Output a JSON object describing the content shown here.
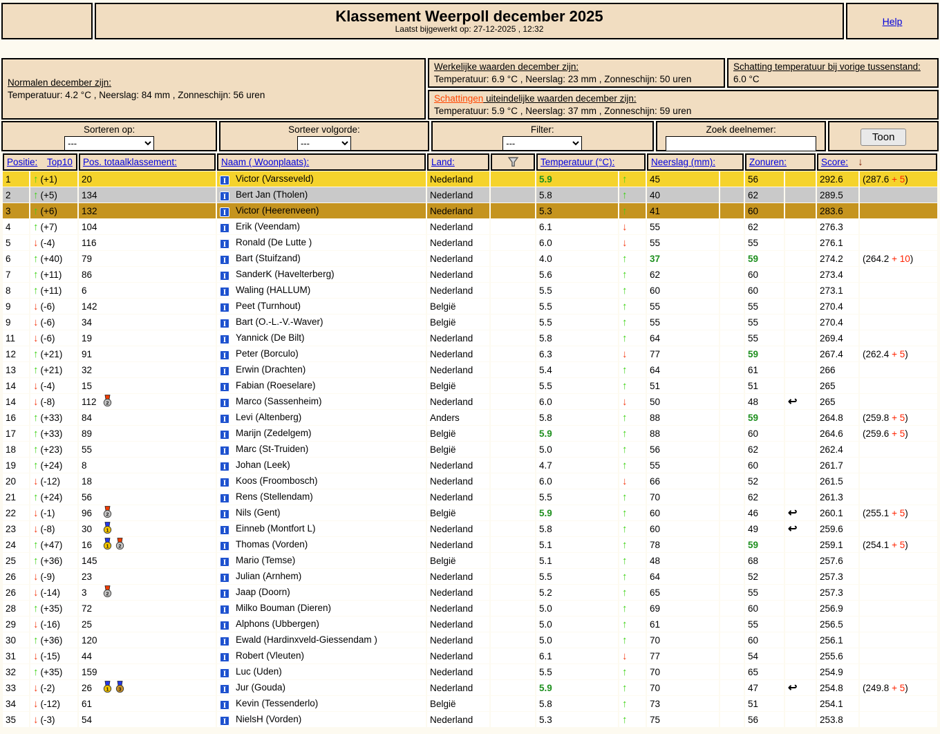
{
  "colors": {
    "page_bg": "#FDFAF0",
    "box_bg": "#F1DDC1",
    "link_blue": "#0000DD",
    "schat_link": "#FF4500",
    "gold_row": "#F5D32C",
    "silver_row": "#C9C9C9",
    "bronze_row": "#C5941F",
    "up_green": "#3BD112",
    "down_red": "#F43B14",
    "hit_green": "#1E8F1E",
    "bonus_red": "#FF2200",
    "score_arrow": "#7A1A00",
    "icon_blue": "#1D51CE"
  },
  "icons": {
    "info": "I",
    "up": "↑",
    "down": "↓",
    "redo": "↩"
  },
  "header": {
    "title": "Klassement Weerpoll december 2025",
    "subtitle": "Laatst bijgewerkt op: 27-12-2025 , 12:32",
    "help_label": "Help"
  },
  "info": {
    "normalen": {
      "title": "Normalen december zijn:",
      "text": "Temperatuur: 4.2 °C , Neerslag: 84 mm , Zonneschijn: 56 uren"
    },
    "werkelijk": {
      "title": "Werkelijke waarden december zijn:",
      "text": "Temperatuur: 6.9 °C , Neerslag: 23 mm , Zonneschijn: 50 uren"
    },
    "schatting_vorige": {
      "title": "Schatting temperatuur bij vorige tussenstand:",
      "text": "6.0 °C"
    },
    "schattingen": {
      "link_text": "Schattingen",
      "title_rest": " uiteindelijke waarden december zijn:",
      "text": "Temperatuur: 5.9 °C , Neerslag: 37 mm , Zonneschijn: 59 uren"
    }
  },
  "controls": {
    "sort_label": "Sorteren op:",
    "sort_value": "---",
    "order_label": "Sorteer volgorde:",
    "order_value": "---",
    "filter_label": "Filter:",
    "filter_value": "---",
    "search_label": "Zoek deelnemer:",
    "search_value": "",
    "show_button": "Toon"
  },
  "table": {
    "headers": {
      "positie": "Positie:",
      "top10": "Top10",
      "pos_totaal": "Pos. totaalklassement:",
      "naam": "Naam ( Woonplaats):",
      "land": "Land:",
      "temperatuur": "Temperatuur (°C):",
      "neerslag": "Neerslag (mm):",
      "zonuren": "Zonuren:",
      "score": "Score:",
      "score_sort_arrow": "↓"
    },
    "medal_defs": {
      "gold1": {
        "num": "1",
        "circle": "#F2C400",
        "ribbon": "#2638E8"
      },
      "silver2": {
        "num": "2",
        "circle": "#C4C4C4",
        "ribbon": "#EE3C00"
      },
      "bronze3": {
        "num": "3",
        "circle": "#C8922A",
        "ribbon": "#2638E8"
      }
    },
    "rows": [
      {
        "positie": "1",
        "delta": "+1",
        "totaal": "20",
        "medals": [],
        "naam": "Victor (Varsseveld)",
        "land": "Nederland",
        "temp": "5.9",
        "temp_hit": true,
        "temp_dir": "up",
        "neerslag": "45",
        "neerslag_hit": false,
        "zonuren": "56",
        "zonuren_hit": false,
        "redo": false,
        "score": "292.6",
        "prev": "287.6",
        "bonus": "5",
        "hl": "gold"
      },
      {
        "positie": "2",
        "delta": "+5",
        "totaal": "134",
        "medals": [],
        "naam": "Bert Jan (Tholen)",
        "land": "Nederland",
        "temp": "5.8",
        "temp_hit": false,
        "temp_dir": "up",
        "neerslag": "40",
        "neerslag_hit": false,
        "zonuren": "62",
        "zonuren_hit": false,
        "redo": false,
        "score": "289.5",
        "prev": null,
        "bonus": null,
        "hl": "silver"
      },
      {
        "positie": "3",
        "delta": "+6",
        "totaal": "132",
        "medals": [],
        "naam": "Victor (Heerenveen)",
        "land": "Nederland",
        "temp": "5.3",
        "temp_hit": false,
        "temp_dir": "up",
        "neerslag": "41",
        "neerslag_hit": false,
        "zonuren": "60",
        "zonuren_hit": false,
        "redo": false,
        "score": "283.6",
        "prev": null,
        "bonus": null,
        "hl": "bronze"
      },
      {
        "positie": "4",
        "delta": "+7",
        "totaal": "104",
        "medals": [],
        "naam": "Erik (Veendam)",
        "land": "Nederland",
        "temp": "6.1",
        "temp_hit": false,
        "temp_dir": "down",
        "neerslag": "55",
        "neerslag_hit": false,
        "zonuren": "62",
        "zonuren_hit": false,
        "redo": false,
        "score": "276.3",
        "prev": null,
        "bonus": null,
        "hl": null
      },
      {
        "positie": "5",
        "delta": "-4",
        "totaal": "116",
        "medals": [],
        "naam": "Ronald (De Lutte )",
        "land": "Nederland",
        "temp": "6.0",
        "temp_hit": false,
        "temp_dir": "down",
        "neerslag": "55",
        "neerslag_hit": false,
        "zonuren": "55",
        "zonuren_hit": false,
        "redo": false,
        "score": "276.1",
        "prev": null,
        "bonus": null,
        "hl": null
      },
      {
        "positie": "6",
        "delta": "+40",
        "totaal": "79",
        "medals": [],
        "naam": "Bart (Stuifzand)",
        "land": "Nederland",
        "temp": "4.0",
        "temp_hit": false,
        "temp_dir": "up",
        "neerslag": "37",
        "neerslag_hit": true,
        "zonuren": "59",
        "zonuren_hit": true,
        "redo": false,
        "score": "274.2",
        "prev": "264.2",
        "bonus": "10",
        "hl": null
      },
      {
        "positie": "7",
        "delta": "+11",
        "totaal": "86",
        "medals": [],
        "naam": "SanderK (Havelterberg)",
        "land": "Nederland",
        "temp": "5.6",
        "temp_hit": false,
        "temp_dir": "up",
        "neerslag": "62",
        "neerslag_hit": false,
        "zonuren": "60",
        "zonuren_hit": false,
        "redo": false,
        "score": "273.4",
        "prev": null,
        "bonus": null,
        "hl": null
      },
      {
        "positie": "8",
        "delta": "+11",
        "totaal": "6",
        "medals": [],
        "naam": "Waling (HALLUM)",
        "land": "Nederland",
        "temp": "5.5",
        "temp_hit": false,
        "temp_dir": "up",
        "neerslag": "60",
        "neerslag_hit": false,
        "zonuren": "60",
        "zonuren_hit": false,
        "redo": false,
        "score": "273.1",
        "prev": null,
        "bonus": null,
        "hl": null
      },
      {
        "positie": "9",
        "delta": "-6",
        "totaal": "142",
        "medals": [],
        "naam": "Peet (Turnhout)",
        "land": "België",
        "temp": "5.5",
        "temp_hit": false,
        "temp_dir": "up",
        "neerslag": "55",
        "neerslag_hit": false,
        "zonuren": "55",
        "zonuren_hit": false,
        "redo": false,
        "score": "270.4",
        "prev": null,
        "bonus": null,
        "hl": null
      },
      {
        "positie": "9",
        "delta": "-6",
        "totaal": "34",
        "medals": [],
        "naam": "Bart (O.-L.-V.-Waver)",
        "land": "België",
        "temp": "5.5",
        "temp_hit": false,
        "temp_dir": "up",
        "neerslag": "55",
        "neerslag_hit": false,
        "zonuren": "55",
        "zonuren_hit": false,
        "redo": false,
        "score": "270.4",
        "prev": null,
        "bonus": null,
        "hl": null
      },
      {
        "positie": "11",
        "delta": "-6",
        "totaal": "19",
        "medals": [],
        "naam": "Yannick (De Bilt)",
        "land": "Nederland",
        "temp": "5.8",
        "temp_hit": false,
        "temp_dir": "up",
        "neerslag": "64",
        "neerslag_hit": false,
        "zonuren": "55",
        "zonuren_hit": false,
        "redo": false,
        "score": "269.4",
        "prev": null,
        "bonus": null,
        "hl": null
      },
      {
        "positie": "12",
        "delta": "+21",
        "totaal": "91",
        "medals": [],
        "naam": "Peter (Borculo)",
        "land": "Nederland",
        "temp": "6.3",
        "temp_hit": false,
        "temp_dir": "down",
        "neerslag": "77",
        "neerslag_hit": false,
        "zonuren": "59",
        "zonuren_hit": true,
        "redo": false,
        "score": "267.4",
        "prev": "262.4",
        "bonus": "5",
        "hl": null
      },
      {
        "positie": "13",
        "delta": "+21",
        "totaal": "32",
        "medals": [],
        "naam": "Erwin (Drachten)",
        "land": "Nederland",
        "temp": "5.4",
        "temp_hit": false,
        "temp_dir": "up",
        "neerslag": "64",
        "neerslag_hit": false,
        "zonuren": "61",
        "zonuren_hit": false,
        "redo": false,
        "score": "266",
        "prev": null,
        "bonus": null,
        "hl": null
      },
      {
        "positie": "14",
        "delta": "-4",
        "totaal": "15",
        "medals": [],
        "naam": "Fabian (Roeselare)",
        "land": "België",
        "temp": "5.5",
        "temp_hit": false,
        "temp_dir": "up",
        "neerslag": "51",
        "neerslag_hit": false,
        "zonuren": "51",
        "zonuren_hit": false,
        "redo": false,
        "score": "265",
        "prev": null,
        "bonus": null,
        "hl": null
      },
      {
        "positie": "14",
        "delta": "-8",
        "totaal": "112",
        "medals": [
          "silver2"
        ],
        "naam": "Marco (Sassenheim)",
        "land": "Nederland",
        "temp": "6.0",
        "temp_hit": false,
        "temp_dir": "down",
        "neerslag": "50",
        "neerslag_hit": false,
        "zonuren": "48",
        "zonuren_hit": false,
        "redo": true,
        "score": "265",
        "prev": null,
        "bonus": null,
        "hl": null
      },
      {
        "positie": "16",
        "delta": "+33",
        "totaal": "84",
        "medals": [],
        "naam": "Levi (Altenberg)",
        "land": "Anders",
        "temp": "5.8",
        "temp_hit": false,
        "temp_dir": "up",
        "neerslag": "88",
        "neerslag_hit": false,
        "zonuren": "59",
        "zonuren_hit": true,
        "redo": false,
        "score": "264.8",
        "prev": "259.8",
        "bonus": "5",
        "hl": null
      },
      {
        "positie": "17",
        "delta": "+33",
        "totaal": "89",
        "medals": [],
        "naam": "Marijn (Zedelgem)",
        "land": "België",
        "temp": "5.9",
        "temp_hit": true,
        "temp_dir": "up",
        "neerslag": "88",
        "neerslag_hit": false,
        "zonuren": "60",
        "zonuren_hit": false,
        "redo": false,
        "score": "264.6",
        "prev": "259.6",
        "bonus": "5",
        "hl": null
      },
      {
        "positie": "18",
        "delta": "+23",
        "totaal": "55",
        "medals": [],
        "naam": "Marc (St-Truiden)",
        "land": "België",
        "temp": "5.0",
        "temp_hit": false,
        "temp_dir": "up",
        "neerslag": "56",
        "neerslag_hit": false,
        "zonuren": "62",
        "zonuren_hit": false,
        "redo": false,
        "score": "262.4",
        "prev": null,
        "bonus": null,
        "hl": null
      },
      {
        "positie": "19",
        "delta": "+24",
        "totaal": "8",
        "medals": [],
        "naam": "Johan (Leek)",
        "land": "Nederland",
        "temp": "4.7",
        "temp_hit": false,
        "temp_dir": "up",
        "neerslag": "55",
        "neerslag_hit": false,
        "zonuren": "60",
        "zonuren_hit": false,
        "redo": false,
        "score": "261.7",
        "prev": null,
        "bonus": null,
        "hl": null
      },
      {
        "positie": "20",
        "delta": "-12",
        "totaal": "18",
        "medals": [],
        "naam": "Koos (Froombosch)",
        "land": "Nederland",
        "temp": "6.0",
        "temp_hit": false,
        "temp_dir": "down",
        "neerslag": "66",
        "neerslag_hit": false,
        "zonuren": "52",
        "zonuren_hit": false,
        "redo": false,
        "score": "261.5",
        "prev": null,
        "bonus": null,
        "hl": null
      },
      {
        "positie": "21",
        "delta": "+24",
        "totaal": "56",
        "medals": [],
        "naam": "Rens (Stellendam)",
        "land": "Nederland",
        "temp": "5.5",
        "temp_hit": false,
        "temp_dir": "up",
        "neerslag": "70",
        "neerslag_hit": false,
        "zonuren": "62",
        "zonuren_hit": false,
        "redo": false,
        "score": "261.3",
        "prev": null,
        "bonus": null,
        "hl": null
      },
      {
        "positie": "22",
        "delta": "-1",
        "totaal": "96",
        "medals": [
          "silver2"
        ],
        "naam": "Nils (Gent)",
        "land": "België",
        "temp": "5.9",
        "temp_hit": true,
        "temp_dir": "up",
        "neerslag": "60",
        "neerslag_hit": false,
        "zonuren": "46",
        "zonuren_hit": false,
        "redo": true,
        "score": "260.1",
        "prev": "255.1",
        "bonus": "5",
        "hl": null
      },
      {
        "positie": "23",
        "delta": "-8",
        "totaal": "30",
        "medals": [
          "gold1"
        ],
        "naam": "Einneb (Montfort L)",
        "land": "Nederland",
        "temp": "5.8",
        "temp_hit": false,
        "temp_dir": "up",
        "neerslag": "60",
        "neerslag_hit": false,
        "zonuren": "49",
        "zonuren_hit": false,
        "redo": true,
        "score": "259.6",
        "prev": null,
        "bonus": null,
        "hl": null
      },
      {
        "positie": "24",
        "delta": "+47",
        "totaal": "16",
        "medals": [
          "gold1",
          "silver2"
        ],
        "naam": "Thomas (Vorden)",
        "land": "Nederland",
        "temp": "5.1",
        "temp_hit": false,
        "temp_dir": "up",
        "neerslag": "78",
        "neerslag_hit": false,
        "zonuren": "59",
        "zonuren_hit": true,
        "redo": false,
        "score": "259.1",
        "prev": "254.1",
        "bonus": "5",
        "hl": null
      },
      {
        "positie": "25",
        "delta": "+36",
        "totaal": "145",
        "medals": [],
        "naam": "Mario (Temse)",
        "land": "België",
        "temp": "5.1",
        "temp_hit": false,
        "temp_dir": "up",
        "neerslag": "48",
        "neerslag_hit": false,
        "zonuren": "68",
        "zonuren_hit": false,
        "redo": false,
        "score": "257.6",
        "prev": null,
        "bonus": null,
        "hl": null
      },
      {
        "positie": "26",
        "delta": "-9",
        "totaal": "23",
        "medals": [],
        "naam": "Julian (Arnhem)",
        "land": "Nederland",
        "temp": "5.5",
        "temp_hit": false,
        "temp_dir": "up",
        "neerslag": "64",
        "neerslag_hit": false,
        "zonuren": "52",
        "zonuren_hit": false,
        "redo": false,
        "score": "257.3",
        "prev": null,
        "bonus": null,
        "hl": null
      },
      {
        "positie": "26",
        "delta": "-14",
        "totaal": "3",
        "medals": [
          "silver2"
        ],
        "naam": "Jaap (Doorn)",
        "land": "Nederland",
        "temp": "5.2",
        "temp_hit": false,
        "temp_dir": "up",
        "neerslag": "65",
        "neerslag_hit": false,
        "zonuren": "55",
        "zonuren_hit": false,
        "redo": false,
        "score": "257.3",
        "prev": null,
        "bonus": null,
        "hl": null
      },
      {
        "positie": "28",
        "delta": "+35",
        "totaal": "72",
        "medals": [],
        "naam": "Milko Bouman (Dieren)",
        "land": "Nederland",
        "temp": "5.0",
        "temp_hit": false,
        "temp_dir": "up",
        "neerslag": "69",
        "neerslag_hit": false,
        "zonuren": "60",
        "zonuren_hit": false,
        "redo": false,
        "score": "256.9",
        "prev": null,
        "bonus": null,
        "hl": null
      },
      {
        "positie": "29",
        "delta": "-16",
        "totaal": "25",
        "medals": [],
        "naam": "Alphons (Ubbergen)",
        "land": "Nederland",
        "temp": "5.0",
        "temp_hit": false,
        "temp_dir": "up",
        "neerslag": "61",
        "neerslag_hit": false,
        "zonuren": "55",
        "zonuren_hit": false,
        "redo": false,
        "score": "256.5",
        "prev": null,
        "bonus": null,
        "hl": null
      },
      {
        "positie": "30",
        "delta": "+36",
        "totaal": "120",
        "medals": [],
        "naam": "Ewald (Hardinxveld-Giessendam )",
        "land": "Nederland",
        "temp": "5.0",
        "temp_hit": false,
        "temp_dir": "up",
        "neerslag": "70",
        "neerslag_hit": false,
        "zonuren": "60",
        "zonuren_hit": false,
        "redo": false,
        "score": "256.1",
        "prev": null,
        "bonus": null,
        "hl": null
      },
      {
        "positie": "31",
        "delta": "-15",
        "totaal": "44",
        "medals": [],
        "naam": "Robert (Vleuten)",
        "land": "Nederland",
        "temp": "6.1",
        "temp_hit": false,
        "temp_dir": "down",
        "neerslag": "77",
        "neerslag_hit": false,
        "zonuren": "54",
        "zonuren_hit": false,
        "redo": false,
        "score": "255.6",
        "prev": null,
        "bonus": null,
        "hl": null
      },
      {
        "positie": "32",
        "delta": "+35",
        "totaal": "159",
        "medals": [],
        "naam": "Luc (Uden)",
        "land": "Nederland",
        "temp": "5.5",
        "temp_hit": false,
        "temp_dir": "up",
        "neerslag": "70",
        "neerslag_hit": false,
        "zonuren": "65",
        "zonuren_hit": false,
        "redo": false,
        "score": "254.9",
        "prev": null,
        "bonus": null,
        "hl": null
      },
      {
        "positie": "33",
        "delta": "-2",
        "totaal": "26",
        "medals": [
          "gold1",
          "bronze3"
        ],
        "naam": "Jur (Gouda)",
        "land": "Nederland",
        "temp": "5.9",
        "temp_hit": true,
        "temp_dir": "up",
        "neerslag": "70",
        "neerslag_hit": false,
        "zonuren": "47",
        "zonuren_hit": false,
        "redo": true,
        "score": "254.8",
        "prev": "249.8",
        "bonus": "5",
        "hl": null
      },
      {
        "positie": "34",
        "delta": "-12",
        "totaal": "61",
        "medals": [],
        "naam": "Kevin (Tessenderlo)",
        "land": "België",
        "temp": "5.8",
        "temp_hit": false,
        "temp_dir": "up",
        "neerslag": "73",
        "neerslag_hit": false,
        "zonuren": "51",
        "zonuren_hit": false,
        "redo": false,
        "score": "254.1",
        "prev": null,
        "bonus": null,
        "hl": null
      },
      {
        "positie": "35",
        "delta": "-3",
        "totaal": "54",
        "medals": [],
        "naam": "NielsH (Vorden)",
        "land": "Nederland",
        "temp": "5.3",
        "temp_hit": false,
        "temp_dir": "up",
        "neerslag": "75",
        "neerslag_hit": false,
        "zonuren": "56",
        "zonuren_hit": false,
        "redo": false,
        "score": "253.8",
        "prev": null,
        "bonus": null,
        "hl": null
      }
    ]
  }
}
